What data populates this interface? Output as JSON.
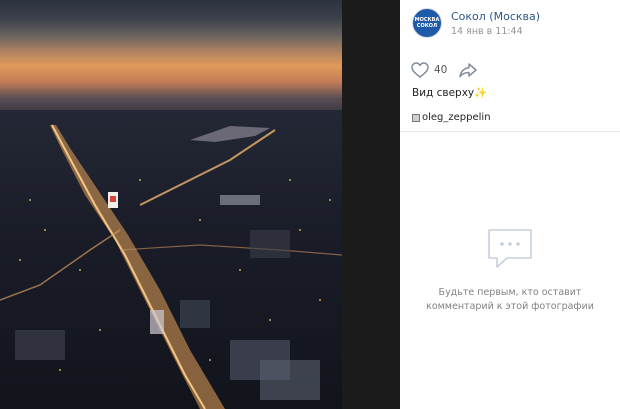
{
  "post": {
    "author": "Сокол (Москва)",
    "date": "14 янв в 11:44",
    "avatar_text": "МОСКВА СОКОЛ",
    "likes": "40",
    "caption": "Вид сверху✨",
    "photo_author": "oleg_zeppelin"
  },
  "comments": {
    "empty_line1": "Будьте первым, кто оставит",
    "empty_line2": "комментарий к этой фотографии"
  },
  "icons": {
    "like": "heart-icon",
    "share": "share-arrow-icon",
    "comments": "speech-bubble-icon",
    "tag": "image-tag-icon"
  },
  "colors": {
    "link": "#2a5885",
    "muted": "#939393",
    "avatar_bg": "#1e5aa8"
  }
}
